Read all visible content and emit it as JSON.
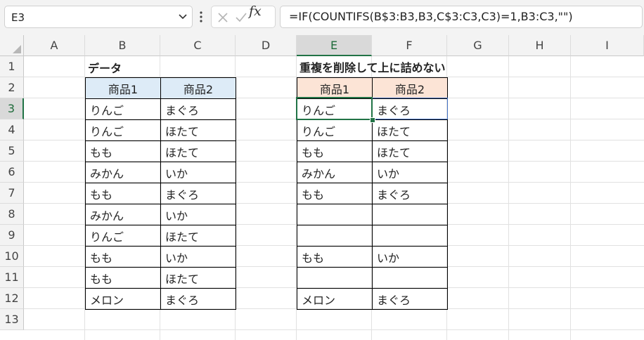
{
  "formula_bar": {
    "name_box": "E3",
    "fx_label": "fx",
    "formula": "=IF(COUNTIFS(B$3:B3,B3,C$3:C3,C3)=1,B3:C3,\"\")"
  },
  "columns": [
    "A",
    "B",
    "C",
    "D",
    "E",
    "F",
    "G",
    "H",
    "I"
  ],
  "rows": [
    "1",
    "2",
    "3",
    "4",
    "5",
    "6",
    "7",
    "8",
    "9",
    "10",
    "11",
    "12",
    "13"
  ],
  "sheet": {
    "title_left": "データ",
    "title_right": "重複を削除して上に詰めない",
    "headers_left": [
      "商品1",
      "商品2"
    ],
    "headers_right": [
      "商品1",
      "商品2"
    ],
    "data_left": [
      [
        "りんご",
        "まぐろ"
      ],
      [
        "りんご",
        "ほたて"
      ],
      [
        "もも",
        "ほたて"
      ],
      [
        "みかん",
        "いか"
      ],
      [
        "もも",
        "まぐろ"
      ],
      [
        "みかん",
        "いか"
      ],
      [
        "りんご",
        "ほたて"
      ],
      [
        "もも",
        "いか"
      ],
      [
        "もも",
        "ほたて"
      ],
      [
        "メロン",
        "まぐろ"
      ]
    ],
    "data_right": [
      [
        "りんご",
        "まぐろ"
      ],
      [
        "りんご",
        "ほたて"
      ],
      [
        "もも",
        "ほたて"
      ],
      [
        "みかん",
        "いか"
      ],
      [
        "もも",
        "まぐろ"
      ],
      [
        "",
        ""
      ],
      [
        "",
        ""
      ],
      [
        "もも",
        "いか"
      ],
      [
        "",
        ""
      ],
      [
        "メロン",
        "まぐろ"
      ]
    ]
  },
  "colors": {
    "selection": "#217346",
    "header_blue": "#ddebf7",
    "header_orange": "#fce4d6"
  }
}
